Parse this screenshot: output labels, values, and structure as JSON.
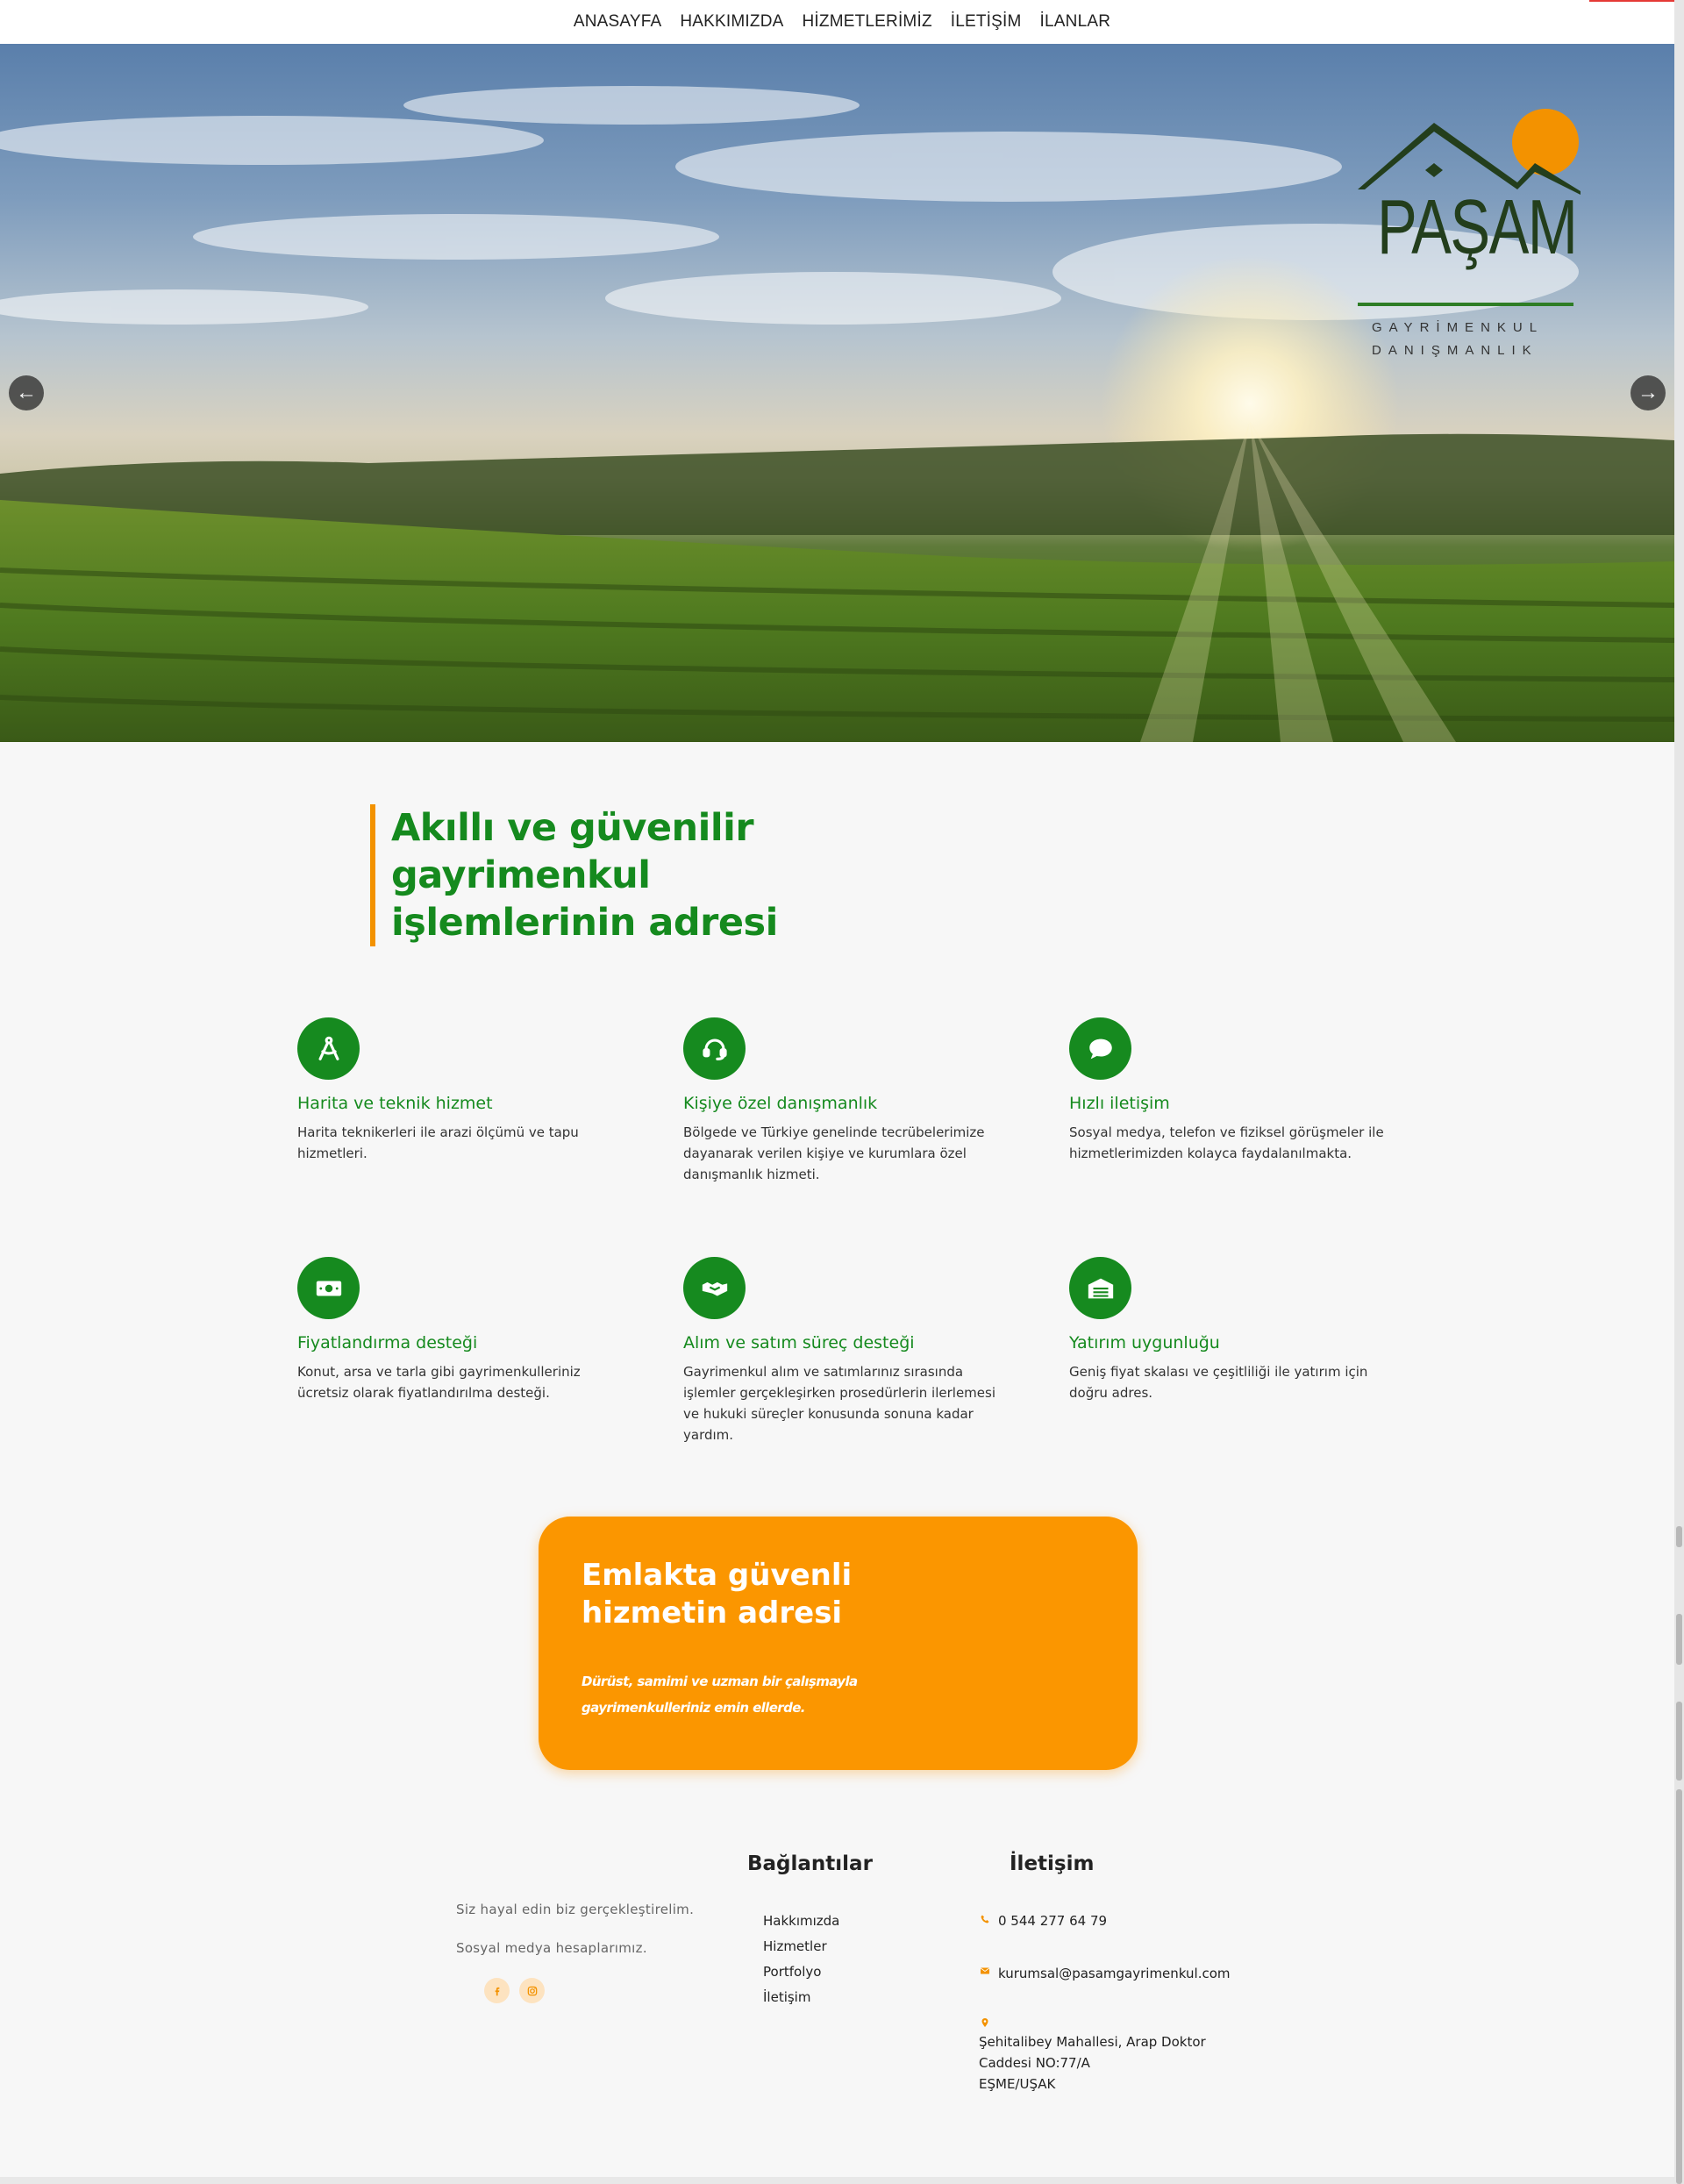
{
  "nav": {
    "items": [
      "ANASAYFA",
      "HAKKIMIZDA",
      "HİZMETLERİMİZ",
      "İLETİŞİM",
      "İLANLAR"
    ]
  },
  "hero": {
    "prev_icon": "arrow-left-icon",
    "next_icon": "arrow-right-icon",
    "prev_glyph": "←",
    "next_glyph": "→"
  },
  "logo": {
    "word": "PAŞAM",
    "sub1": "GAYRİMENKUL",
    "sub2": "DANIŞMANLIK"
  },
  "intro": {
    "heading": "Akıllı ve güvenilir gayrimenkul işlemlerinin adresi"
  },
  "features": [
    {
      "icon": "compass-icon",
      "title": "Harita ve teknik hizmet",
      "desc": "Harita teknikerleri ile arazi ölçümü ve tapu hizmetleri."
    },
    {
      "icon": "headset-icon",
      "title": "Kişiye özel danışmanlık",
      "desc": "Bölgede ve Türkiye genelinde tecrübelerimize dayanarak verilen kişiye ve kurumlara özel danışmanlık hizmeti."
    },
    {
      "icon": "chat-bubble-icon",
      "title": "Hızlı iletişim",
      "desc": "Sosyal medya, telefon ve fiziksel görüşmeler ile hizmetlerimizden kolayca faydalanılmakta."
    },
    {
      "icon": "money-bill-icon",
      "title": "Fiyatlandırma desteği",
      "desc": "Konut, arsa ve tarla gibi gayrimenkulleriniz ücretsiz olarak fiyatlandırılma desteği."
    },
    {
      "icon": "handshake-icon",
      "title": "Alım ve satım süreç desteği",
      "desc": "Gayrimenkul alım ve satımlarınız sırasında işlemler gerçekleşirken prosedürlerin ilerlemesi ve hukuki süreçler konusunda sonuna kadar yardım."
    },
    {
      "icon": "warehouse-icon",
      "title": "Yatırım uygunluğu",
      "desc": "Geniş fiyat skalası ve çeşitliliği ile yatırım için doğru adres."
    }
  ],
  "promo": {
    "heading": "Emlakta güvenli hizmetin adresi",
    "text": "Dürüst, samimi ve uzman bir çalışmayla gayrimenkulleriniz emin ellerde."
  },
  "footer": {
    "tagline": "Siz hayal edin biz gerçekleştirelim.",
    "social_text": "Sosyal medya hesaplarımız.",
    "social": [
      "facebook-icon",
      "instagram-icon"
    ],
    "links_heading": "Bağlantılar",
    "links": [
      "Hakkımızda",
      "Hizmetler",
      "Portfolyo",
      "İletişim"
    ],
    "contact_heading": "İletişim",
    "phone": "0 544 277 64 79",
    "email": "kurumsal@pasamgayrimenkul.com",
    "address_line1": "Şehitalibey Mahallesi, Arap Doktor",
    "address_line2": "Caddesi NO:77/A",
    "address_line3": "EŞME/UŞAK",
    "accent_color": "#f39200"
  },
  "colors": {
    "brand_green": "#158a1e",
    "accent_orange": "#fb9600"
  }
}
